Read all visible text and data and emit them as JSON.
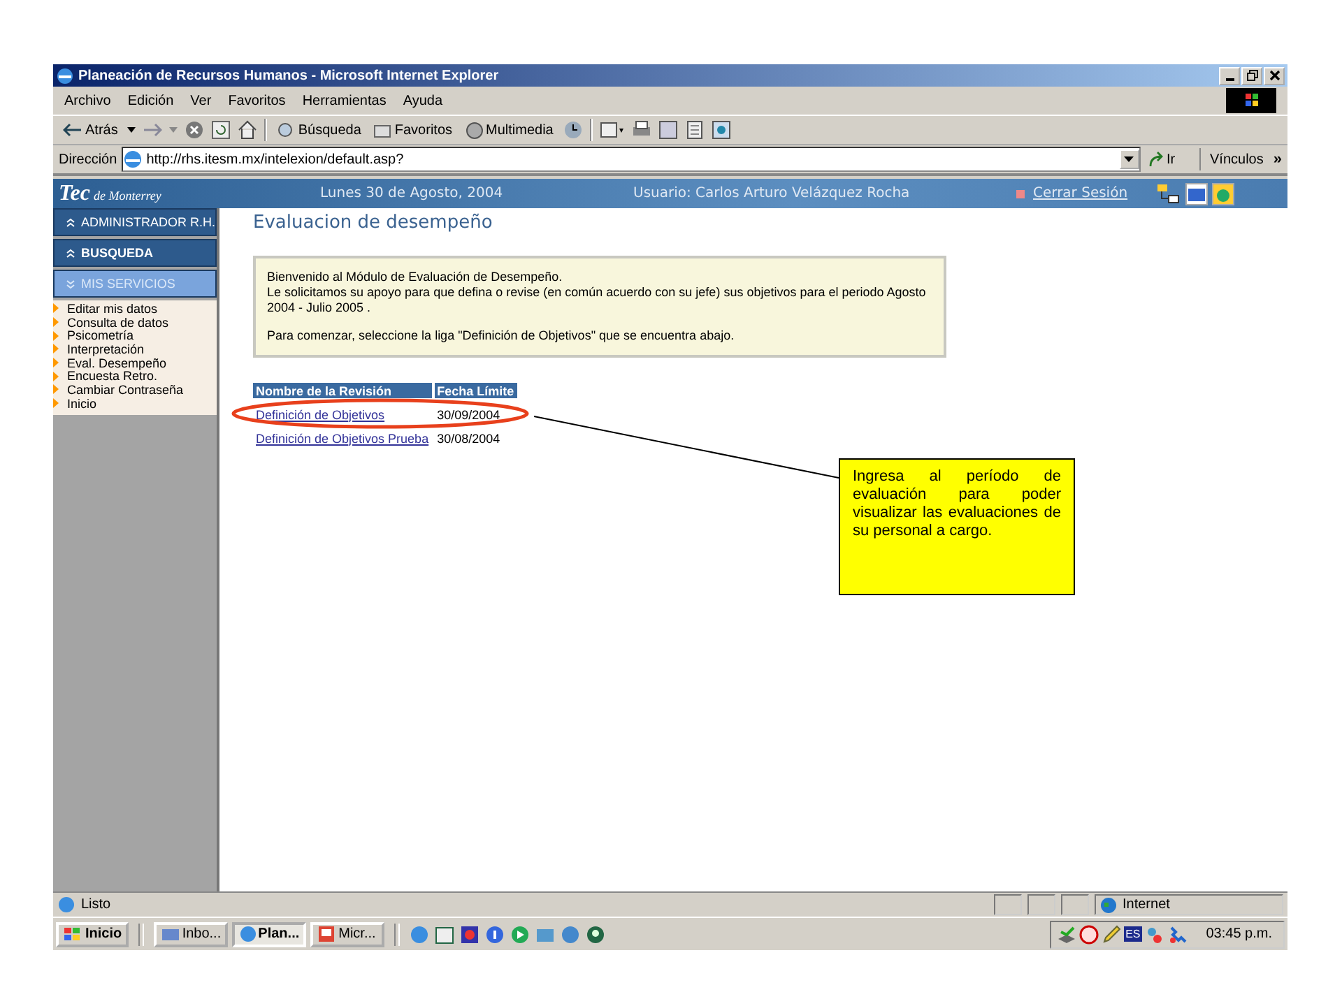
{
  "window": {
    "title": "Planeación de Recursos Humanos - Microsoft Internet Explorer"
  },
  "menu": [
    "Archivo",
    "Edición",
    "Ver",
    "Favoritos",
    "Herramientas",
    "Ayuda"
  ],
  "toolbar": {
    "back": "Atrás",
    "search": "Búsqueda",
    "favorites": "Favoritos",
    "media": "Multimedia"
  },
  "address": {
    "label": "Dirección",
    "value": "http://rhs.itesm.mx/intelexion/default.asp?",
    "go": "Ir",
    "links": "Vínculos",
    "more": "»"
  },
  "site_header": {
    "logo_main": "Tec",
    "logo_sub": "de Monterrey",
    "date": "Lunes 30 de Agosto, 2004",
    "user": "Usuario: Carlos Arturo Velázquez Rocha",
    "logout": "Cerrar Sesión"
  },
  "sidebar": {
    "sections": [
      {
        "label": "ADMINISTRADOR R.H.",
        "expanded": false
      },
      {
        "label": "BUSQUEDA",
        "expanded": false
      },
      {
        "label": "MIS SERVICIOS",
        "expanded": true
      }
    ],
    "items": [
      "Editar mis datos",
      "Consulta de datos",
      "Psicometría",
      "Interpretación",
      "Eval. Desempeño",
      "Encuesta Retro.",
      "Cambiar Contraseña",
      "Inicio"
    ]
  },
  "page": {
    "title": "Evaluacion de desempeño",
    "notice": {
      "lines": [
        "Bienvenido al Módulo de Evaluación de Desempeño.",
        "Le solicitamos su apoyo para que defina o revise (en común acuerdo con su jefe) sus objetivos para el periodo Agosto 2004 - Julio 2005 ."
      ],
      "instruction": "Para comenzar, seleccione la liga \"Definición de Objetivos\" que se encuentra abajo."
    },
    "table": {
      "columns": [
        "Nombre de la Revisión",
        "Fecha Límite"
      ],
      "rows": [
        {
          "name": "Definición de Objetivos",
          "date": "30/09/2004"
        },
        {
          "name": "Definición de Objetivos Prueba",
          "date": "30/08/2004"
        }
      ]
    }
  },
  "callout": {
    "text": "Ingresa al período de evaluación para poder visualizar las evaluaciones de su personal a cargo."
  },
  "status_bar": {
    "text": "Listo",
    "zone": "Internet"
  },
  "taskbar": {
    "start": "Inicio",
    "tasks": [
      {
        "label": "Inbo...",
        "selected": false
      },
      {
        "label": "Plan...",
        "selected": true
      },
      {
        "label": "Micr...",
        "selected": false
      }
    ],
    "language": "ES",
    "clock": "03:45 p.m."
  }
}
